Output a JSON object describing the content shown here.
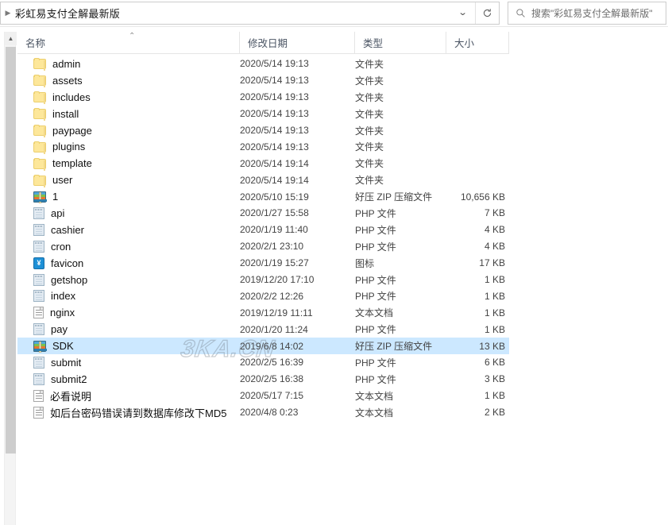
{
  "window": {
    "address": {
      "breadcrumb": "彩虹易支付全解最新版",
      "chevron_icon": "chevron-right-icon",
      "dropdown_icon": "chevron-down-icon",
      "refresh_icon": "refresh-icon"
    },
    "search": {
      "icon": "search-icon",
      "placeholder": "搜索\"彩虹易支付全解最新版\""
    }
  },
  "columns": {
    "name": "名称",
    "date": "修改日期",
    "type": "类型",
    "size": "大小",
    "sort_indicator": "⌃"
  },
  "scrollbar": {
    "up_arrow_icon": "chevron-up-icon"
  },
  "watermark": "3KA.CN",
  "colors": {
    "selection": "#cce8ff",
    "folder": "#fde79a",
    "header_text": "#4a5463"
  },
  "files": [
    {
      "name": "admin",
      "date": "2020/5/14 19:13",
      "type": "文件夹",
      "size": "",
      "icon": "folder-icon",
      "selected": false
    },
    {
      "name": "assets",
      "date": "2020/5/14 19:13",
      "type": "文件夹",
      "size": "",
      "icon": "folder-icon",
      "selected": false
    },
    {
      "name": "includes",
      "date": "2020/5/14 19:13",
      "type": "文件夹",
      "size": "",
      "icon": "folder-icon",
      "selected": false
    },
    {
      "name": "install",
      "date": "2020/5/14 19:13",
      "type": "文件夹",
      "size": "",
      "icon": "folder-icon",
      "selected": false
    },
    {
      "name": "paypage",
      "date": "2020/5/14 19:13",
      "type": "文件夹",
      "size": "",
      "icon": "folder-icon",
      "selected": false
    },
    {
      "name": "plugins",
      "date": "2020/5/14 19:13",
      "type": "文件夹",
      "size": "",
      "icon": "folder-icon",
      "selected": false
    },
    {
      "name": "template",
      "date": "2020/5/14 19:14",
      "type": "文件夹",
      "size": "",
      "icon": "folder-icon",
      "selected": false
    },
    {
      "name": "user",
      "date": "2020/5/14 19:14",
      "type": "文件夹",
      "size": "",
      "icon": "folder-icon",
      "selected": false
    },
    {
      "name": "1",
      "date": "2020/5/10 15:19",
      "type": "好压 ZIP 压缩文件",
      "size": "10,656 KB",
      "icon": "zip-archive-icon",
      "selected": false
    },
    {
      "name": "api",
      "date": "2020/1/27 15:58",
      "type": "PHP 文件",
      "size": "7 KB",
      "icon": "php-file-icon",
      "selected": false
    },
    {
      "name": "cashier",
      "date": "2020/1/19 11:40",
      "type": "PHP 文件",
      "size": "4 KB",
      "icon": "php-file-icon",
      "selected": false
    },
    {
      "name": "cron",
      "date": "2020/2/1 23:10",
      "type": "PHP 文件",
      "size": "4 KB",
      "icon": "php-file-icon",
      "selected": false
    },
    {
      "name": "favicon",
      "date": "2020/1/19 15:27",
      "type": "图标",
      "size": "17 KB",
      "icon": "icon-file-icon",
      "selected": false
    },
    {
      "name": "getshop",
      "date": "2019/12/20 17:10",
      "type": "PHP 文件",
      "size": "1 KB",
      "icon": "php-file-icon",
      "selected": false
    },
    {
      "name": "index",
      "date": "2020/2/2 12:26",
      "type": "PHP 文件",
      "size": "1 KB",
      "icon": "php-file-icon",
      "selected": false
    },
    {
      "name": "nginx",
      "date": "2019/12/19 11:11",
      "type": "文本文档",
      "size": "1 KB",
      "icon": "text-file-icon",
      "selected": false
    },
    {
      "name": "pay",
      "date": "2020/1/20 11:24",
      "type": "PHP 文件",
      "size": "1 KB",
      "icon": "php-file-icon",
      "selected": false
    },
    {
      "name": "SDK",
      "date": "2019/6/8 14:02",
      "type": "好压 ZIP 压缩文件",
      "size": "13 KB",
      "icon": "zip-archive-icon",
      "selected": true
    },
    {
      "name": "submit",
      "date": "2020/2/5 16:39",
      "type": "PHP 文件",
      "size": "6 KB",
      "icon": "php-file-icon",
      "selected": false
    },
    {
      "name": "submit2",
      "date": "2020/2/5 16:38",
      "type": "PHP 文件",
      "size": "3 KB",
      "icon": "php-file-icon",
      "selected": false
    },
    {
      "name": "必看说明",
      "date": "2020/5/17 7:15",
      "type": "文本文档",
      "size": "1 KB",
      "icon": "text-file-icon",
      "selected": false
    },
    {
      "name": "如后台密码错误请到数据库修改下MD5",
      "date": "2020/4/8 0:23",
      "type": "文本文档",
      "size": "2 KB",
      "icon": "text-file-icon",
      "selected": false
    }
  ]
}
